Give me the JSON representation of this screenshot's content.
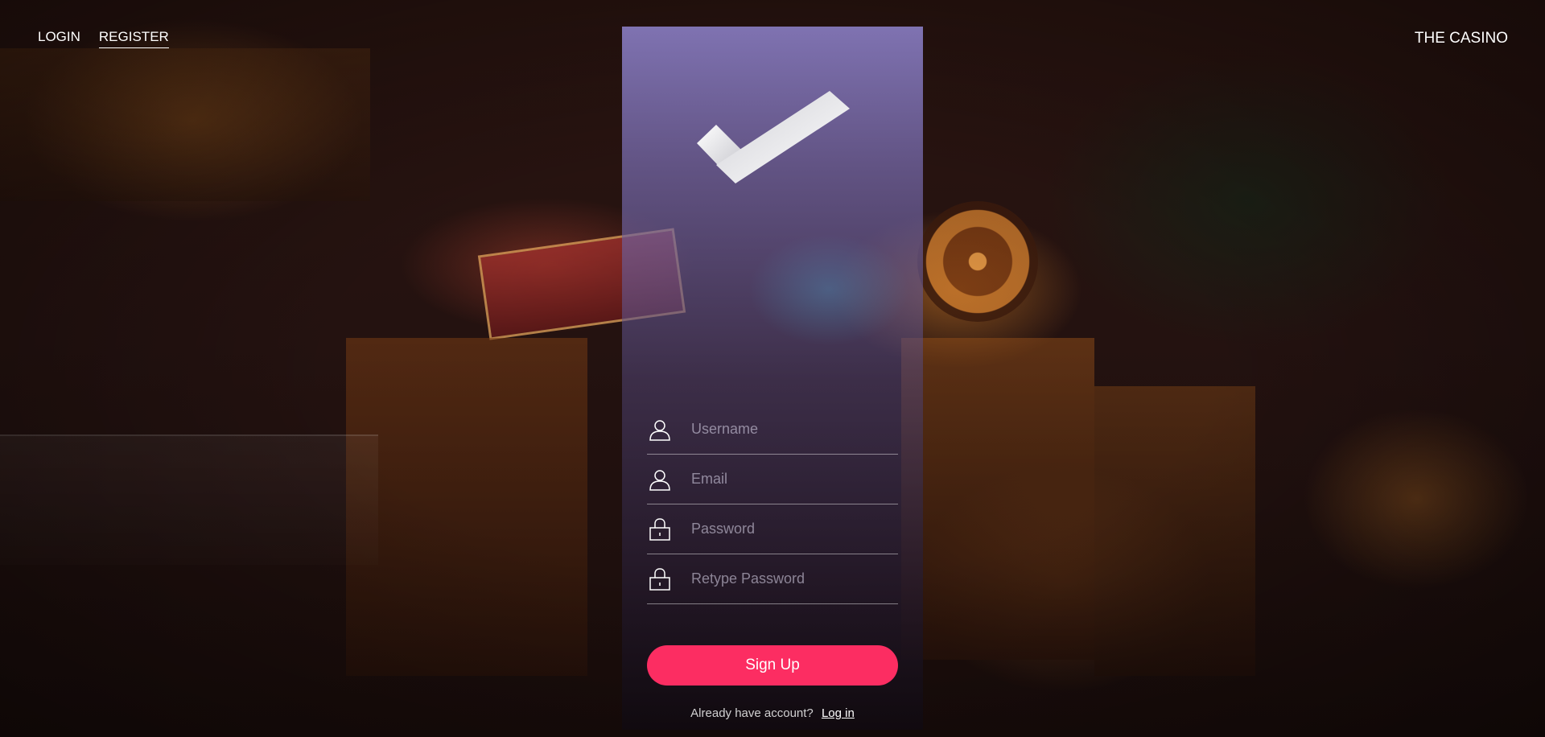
{
  "nav": {
    "login_label": "LOGIN",
    "register_label": "REGISTER"
  },
  "brand": {
    "title": "THE CASINO"
  },
  "logo": {
    "icon": "checkmark-icon"
  },
  "form": {
    "fields": [
      {
        "icon": "user-icon",
        "placeholder": "Username",
        "value": ""
      },
      {
        "icon": "user-icon",
        "placeholder": "Email",
        "value": ""
      },
      {
        "icon": "lock-icon",
        "placeholder": "Password",
        "value": ""
      },
      {
        "icon": "lock-icon",
        "placeholder": "Retype Password",
        "value": ""
      }
    ],
    "submit_label": "Sign Up"
  },
  "footer": {
    "prompt": "Already have account?",
    "link_label": "Log in"
  },
  "colors": {
    "accent": "#fc2d62",
    "panel_top": "#8c80c8",
    "text": "#ffffff"
  }
}
